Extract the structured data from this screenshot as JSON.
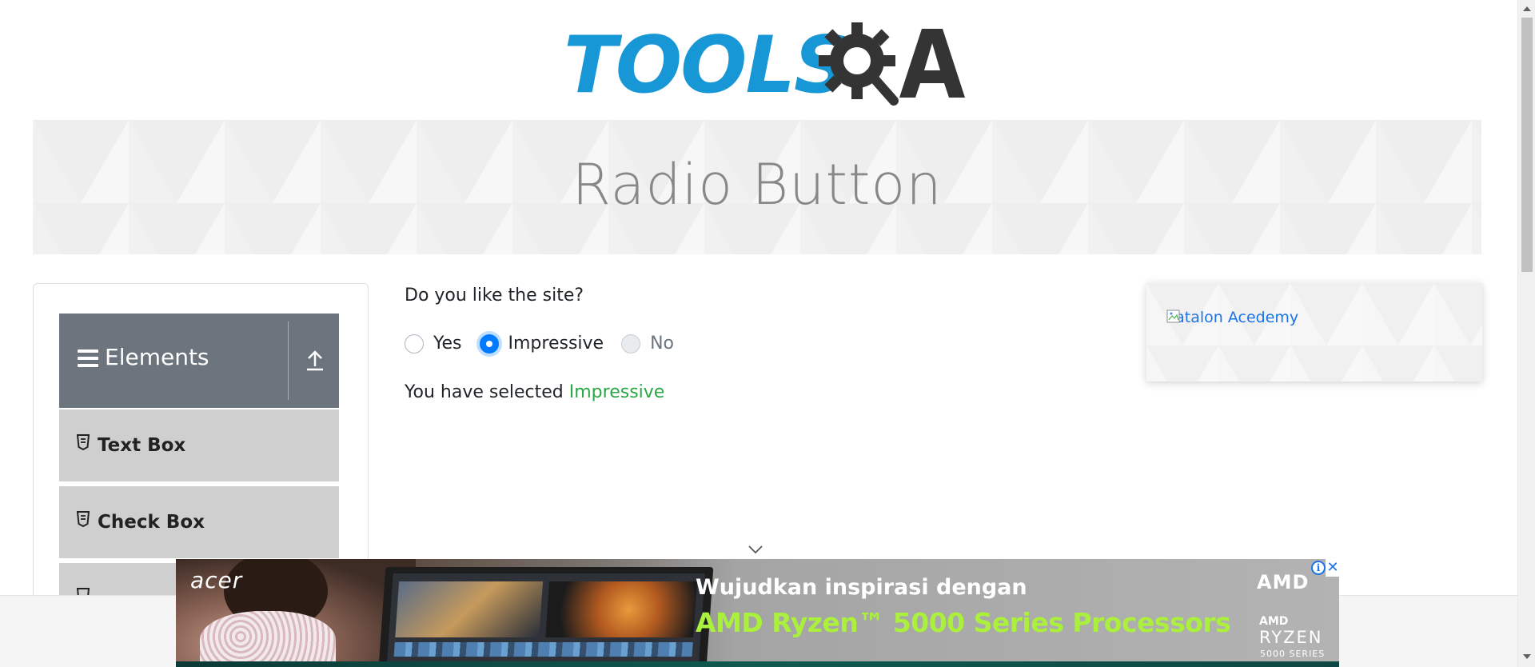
{
  "logo": {
    "text": "TOOLS",
    "suffix": "A",
    "colors": {
      "tools": "#1797d5",
      "qa": "#343434"
    }
  },
  "banner": {
    "title": "Radio Button"
  },
  "sidebar": {
    "group_title": "Elements",
    "group_icon": "hamburger-icon",
    "toggle_icon": "collapse-arrow-icon",
    "items": [
      {
        "label": "Text Box",
        "icon": "html5-icon"
      },
      {
        "label": "Check Box",
        "icon": "html5-icon"
      }
    ]
  },
  "main": {
    "question": "Do you like the site?",
    "options": [
      {
        "label": "Yes",
        "checked": false,
        "disabled": false
      },
      {
        "label": "Impressive",
        "checked": true,
        "disabled": false
      },
      {
        "label": "No",
        "checked": false,
        "disabled": true
      }
    ],
    "result_prefix": "You have selected ",
    "result_value": "Impressive"
  },
  "ad_card": {
    "link_text": "Katalon Acedemy"
  },
  "ad_banner": {
    "brand": "acer",
    "line1": "Wujudkan inspirasi dengan",
    "line2": "AMD Ryzen™ 5000 Series Processors",
    "amd_logo": "AMD",
    "amd_small": "AMD",
    "ryzen": "RYZEN",
    "series": "5000 SERIES",
    "info_symbol": "i",
    "close_symbol": "✕"
  },
  "colors": {
    "accent": "#007bff",
    "success": "#28a745",
    "sidebar_header": "#6c757d",
    "sidebar_item": "#cfcfcf"
  }
}
